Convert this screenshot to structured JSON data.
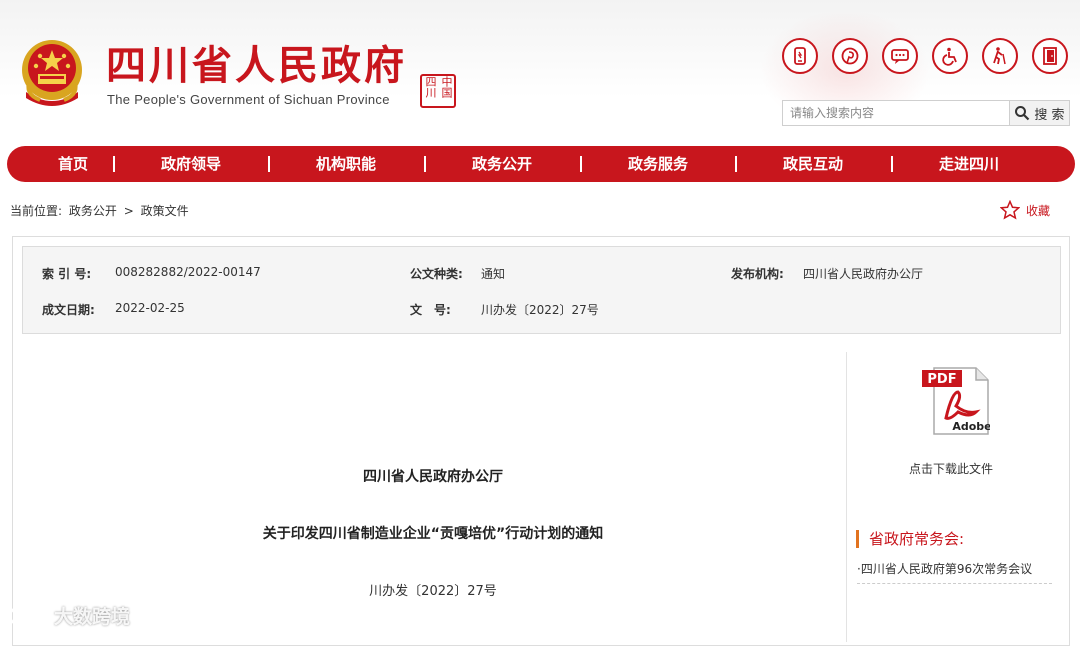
{
  "header": {
    "title": "四川省人民政府",
    "subtitle": "The People's Government of Sichuan Province",
    "seal_text": "中国四川",
    "tools": [
      {
        "icon": "mobile-icon"
      },
      {
        "icon": "pinterest-icon"
      },
      {
        "icon": "message-icon"
      },
      {
        "icon": "accessibility-icon"
      },
      {
        "icon": "elderly-icon"
      },
      {
        "icon": "exit-icon"
      }
    ],
    "search": {
      "placeholder": "请输入搜索内容",
      "button_label": "搜 索"
    }
  },
  "nav": {
    "items": [
      "首页",
      "政府领导",
      "机构职能",
      "政务公开",
      "政务服务",
      "政民互动",
      "走进四川"
    ]
  },
  "breadcrumb": {
    "prefix": "当前位置:",
    "items": [
      "政务公开",
      "政策文件"
    ],
    "separator": ">"
  },
  "favorite_label": "收藏",
  "meta": {
    "index_label": "索 引 号:",
    "index_value": "008282882/2022-00147",
    "type_label": "公文种类:",
    "type_value": "通知",
    "publisher_label": "发布机构:",
    "publisher_value": "四川省人民政府办公厅",
    "date_label": "成文日期:",
    "date_value": "2022-02-25",
    "docno_label": "文　号:",
    "docno_value": "川办发〔2022〕27号"
  },
  "sidebar": {
    "pdf_badge": "PDF",
    "pdf_brand": "Adobe",
    "pdf_caption": "点击下载此文件",
    "meeting_title": "省政府常务会:",
    "meeting_item": "·四川省人民政府第96次常务会议"
  },
  "document": {
    "issuer": "四川省人民政府办公厅",
    "title": "关于印发四川省制造业企业“贡嘎培优”行动计划的通知",
    "number": "川办发〔2022〕27号"
  },
  "watermark": "大数跨境",
  "colors": {
    "brand_red": "#c8161d",
    "accent_orange": "#e2731f"
  }
}
